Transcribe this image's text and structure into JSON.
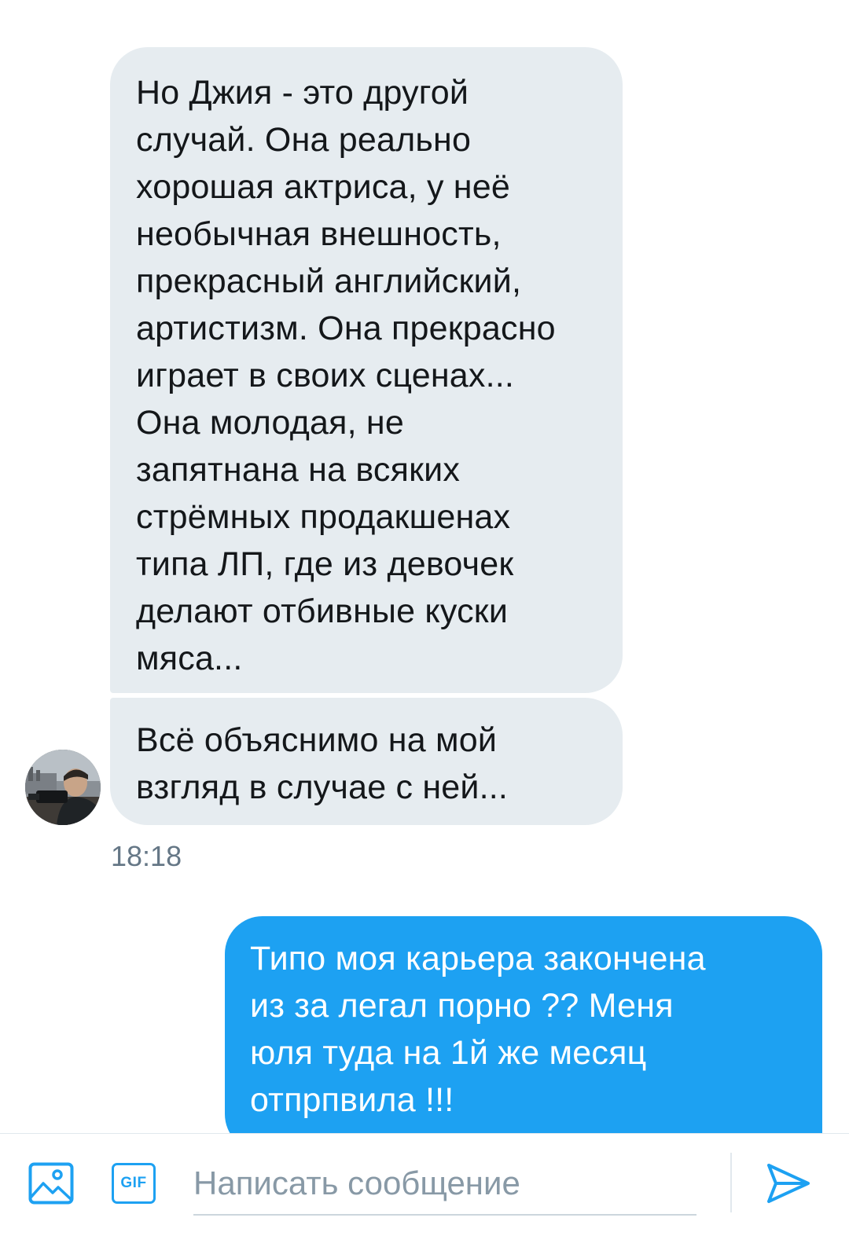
{
  "conversation": {
    "messages": [
      {
        "direction": "incoming",
        "lines": [
          "Но Джия - это другой",
          "случай. Она реально",
          "хорошая актриса, у неё",
          "необычная внешность,",
          "прекрасный английский,",
          "артистизм. Она прекрасно",
          "играет в своих сценах...",
          "Она молодая, не",
          "запятнана на всяких",
          "стрёмных продакшенах",
          "типа ЛП, где из девочек",
          "делают отбивные куски",
          "мяса..."
        ]
      },
      {
        "direction": "incoming",
        "lines": [
          "Всё объяснимо на мой",
          "взгляд в случае с ней..."
        ]
      },
      {
        "direction": "outgoing",
        "lines": [
          "Типо моя карьера закончена",
          "из за легал порно ?? Меня",
          "юля туда на 1й же месяц",
          "отпрпвила !!!"
        ]
      }
    ],
    "timestamp": "18:18",
    "avatar_icon": "user-photo-avatar"
  },
  "composer": {
    "placeholder": "Написать сообщение",
    "media_icon": "image-icon",
    "gif_label": "GIF",
    "send_icon": "send-icon"
  },
  "colors": {
    "incoming_bubble": "#e6ecf0",
    "outgoing_bubble": "#1da1f2",
    "accent": "#1da1f2",
    "timestamp": "#657786",
    "placeholder": "#8899a6"
  }
}
